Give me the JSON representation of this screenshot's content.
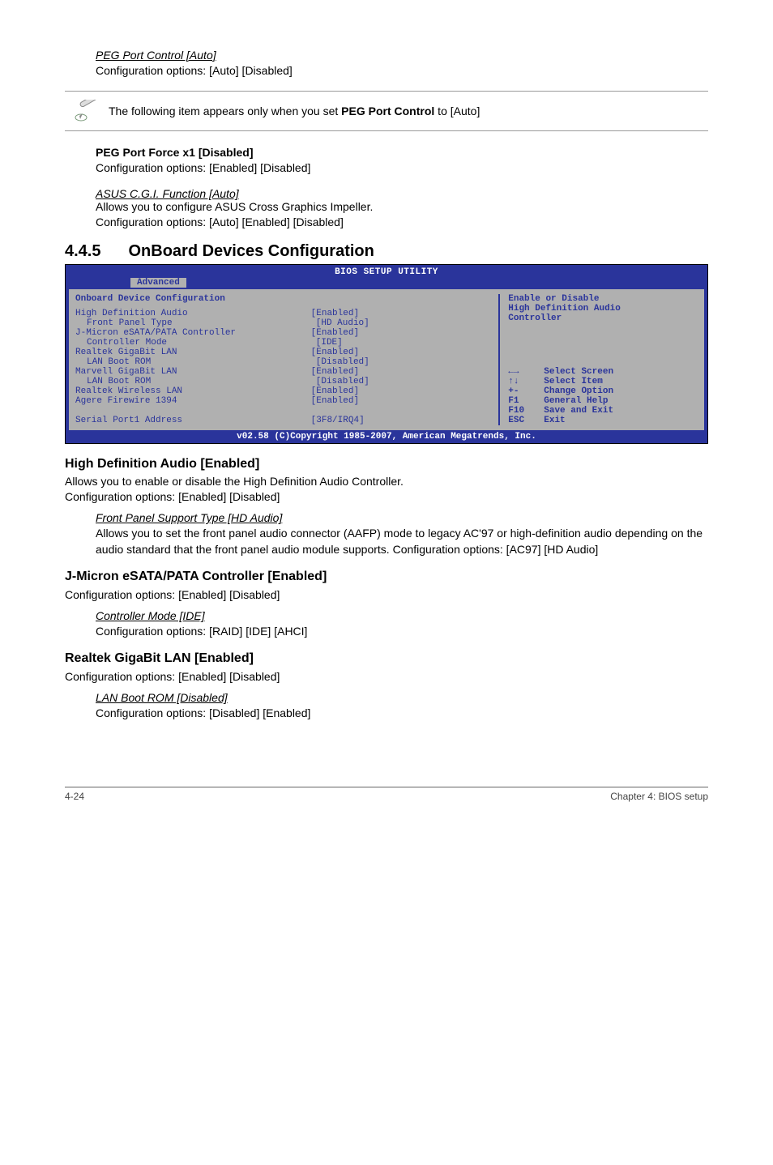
{
  "top": {
    "peg_port_control_heading": "PEG Port Control [Auto]",
    "peg_port_control_text": "Configuration options: [Auto] [Disabled]",
    "note_text_prefix": "The following item appears only when you set ",
    "note_bold": "PEG Port Control",
    "note_text_suffix": " to [Auto]",
    "peg_port_force_heading": "PEG Port Force x1 [Disabled]",
    "peg_port_force_text": "Configuration options: [Enabled] [Disabled]",
    "asus_cgi_heading": "ASUS C.G.I. Function [Auto]",
    "asus_cgi_line1": "Allows you to configure ASUS Cross Graphics Impeller.",
    "asus_cgi_line2": "Configuration options: [Auto] [Enabled] [Disabled]"
  },
  "h2_number": "4.4.5",
  "h2_title": "OnBoard Devices Configuration",
  "bios": {
    "title": "BIOS SETUP UTILITY",
    "tab": "Advanced",
    "left_header": "Onboard Device Configuration",
    "rows": [
      {
        "label": "High Definition Audio",
        "value": "[Enabled]",
        "indent": false
      },
      {
        "label": "Front Panel Type",
        "value": "[HD Audio]",
        "indent": true
      },
      {
        "label": "J-Micron eSATA/PATA Controller",
        "value": "[Enabled]",
        "indent": false
      },
      {
        "label": "Controller Mode",
        "value": "[IDE]",
        "indent": true
      },
      {
        "label": "Realtek GigaBit LAN",
        "value": "[Enabled]",
        "indent": false
      },
      {
        "label": "LAN Boot ROM",
        "value": "[Disabled]",
        "indent": true
      },
      {
        "label": "Marvell GigaBit LAN",
        "value": "[Enabled]",
        "indent": false
      },
      {
        "label": "LAN Boot ROM",
        "value": "[Disabled]",
        "indent": true
      },
      {
        "label": "Realtek Wireless LAN",
        "value": "[Enabled]",
        "indent": false
      },
      {
        "label": "Agere Firewire 1394",
        "value": "[Enabled]",
        "indent": false
      },
      {
        "label": " ",
        "value": " ",
        "indent": false
      },
      {
        "label": "Serial Port1 Address",
        "value": "[3F8/IRQ4]",
        "indent": false
      }
    ],
    "help_lines": [
      "Enable or Disable",
      "High Definition Audio",
      "Controller"
    ],
    "nav": [
      {
        "key": "←→",
        "label": "Select Screen"
      },
      {
        "key": "↑↓",
        "label": "Select Item"
      },
      {
        "key": "+-",
        "label": "Change Option"
      },
      {
        "key": "F1",
        "label": "General Help"
      },
      {
        "key": "F10",
        "label": "Save and Exit"
      },
      {
        "key": "ESC",
        "label": "Exit"
      }
    ],
    "copyright": "v02.58 (C)Copyright 1985-2007, American Megatrends, Inc."
  },
  "configs": {
    "hda_heading": "High Definition Audio [Enabled]",
    "hda_line1": "Allows you to enable or disable the High Definition Audio Controller.",
    "hda_line2": "Configuration options: [Enabled] [Disabled]",
    "front_panel_heading": "Front Panel Support Type [HD Audio]",
    "front_panel_text": "Allows you to set the front panel audio connector (AAFP) mode to legacy AC'97 or high-definition audio depending on the audio standard that the front panel audio module supports. Configuration options: [AC97] [HD Audio]",
    "jmicron_heading": "J-Micron eSATA/PATA Controller [Enabled]",
    "jmicron_text": "Configuration options: [Enabled] [Disabled]",
    "controller_mode_heading": "Controller Mode [IDE]",
    "controller_mode_text": "Configuration options: [RAID] [IDE] [AHCI]",
    "realtek_heading": "Realtek GigaBit LAN [Enabled]",
    "realtek_text": "Configuration options: [Enabled] [Disabled]",
    "lanboot_heading": "LAN Boot ROM [Disabled]",
    "lanboot_text": "Configuration options: [Disabled] [Enabled]"
  },
  "footer": {
    "left": "4-24",
    "right": "Chapter 4: BIOS setup"
  }
}
